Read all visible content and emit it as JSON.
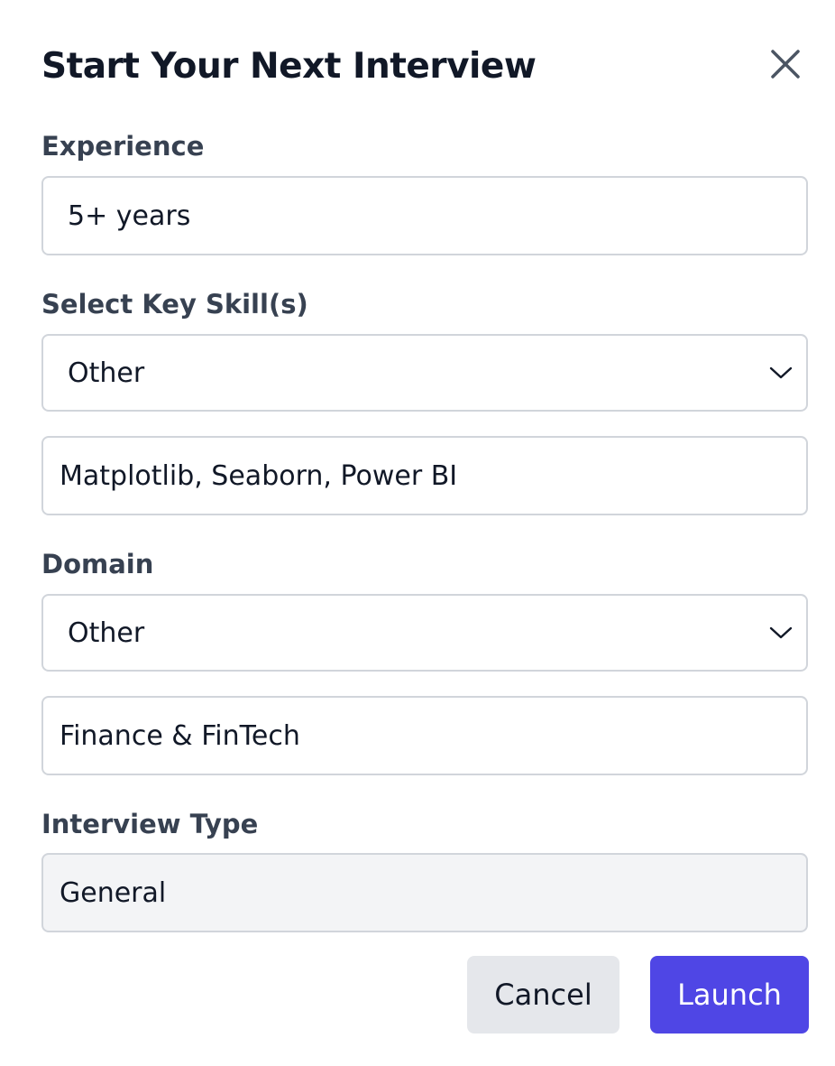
{
  "dialog": {
    "title": "Start Your Next Interview"
  },
  "experience": {
    "label": "Experience",
    "value": "5+ years"
  },
  "skills": {
    "label": "Select Key Skill(s)",
    "selected": "Other",
    "custom_value": "Matplotlib, Seaborn, Power BI"
  },
  "domain": {
    "label": "Domain",
    "selected": "Other",
    "custom_value": "Finance & FinTech"
  },
  "interview_type": {
    "label": "Interview Type",
    "value": "General"
  },
  "actions": {
    "cancel_label": "Cancel",
    "launch_label": "Launch"
  },
  "colors": {
    "primary": "#4f46e5",
    "cancel_bg": "#e5e7eb",
    "disabled_bg": "#f3f4f6",
    "border": "#d1d5db",
    "label": "#374151"
  },
  "icons": {
    "close": "close-icon",
    "dropdown": "chevron-down-icon"
  }
}
